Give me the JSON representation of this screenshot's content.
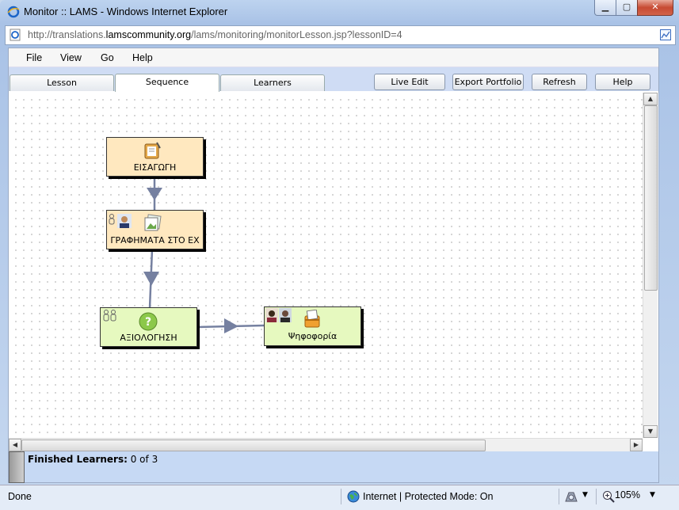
{
  "window": {
    "title": "Monitor :: LAMS - Windows Internet Explorer"
  },
  "address": {
    "url_prefix": "http://translations.",
    "url_domain": "lamscommunity.org",
    "url_suffix": "/lams/monitoring/monitorLesson.jsp?lessonID=4"
  },
  "menu": {
    "items": [
      "File",
      "View",
      "Go",
      "Help"
    ]
  },
  "tabs": [
    {
      "label": "Lesson",
      "active": false
    },
    {
      "label": "Sequence",
      "active": true
    },
    {
      "label": "Learners",
      "active": false
    }
  ],
  "actions": {
    "live_edit": "Live Edit",
    "export_portfolio": "Export Portfolio",
    "refresh": "Refresh",
    "help": "Help"
  },
  "activities": [
    {
      "label": "ΕΙΣΑΓΩΓΗ",
      "color": "#ffe8bf"
    },
    {
      "label": "ΓΡΑΦΗΜΑΤΑ ΣΤΟ ΕΧ",
      "color": "#ffe8bf"
    },
    {
      "label": "ΑΞΙΟΛΟΓΗΣΗ",
      "color": "#e6f9bf"
    },
    {
      "label": "Ψηφοφορία",
      "color": "#e6f9bf"
    }
  ],
  "learners": {
    "label": "Finished Learners:",
    "value": "0 of 3"
  },
  "status": {
    "done": "Done",
    "zone": "Internet | Protected Mode: On",
    "zoom": "105%"
  },
  "colors": {
    "arrow": "#7580a0",
    "tab_bar": "#cfdcf4",
    "learners_bar": "#c6d9f4"
  }
}
